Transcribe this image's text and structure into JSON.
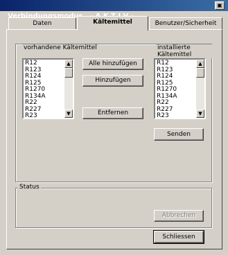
{
  "window": {
    "title": "Verbindungsmodus   - A K T I V -",
    "button_glyph": "▣"
  },
  "tabs": [
    {
      "label": "Daten"
    },
    {
      "label": "Kältemittel"
    },
    {
      "label": "Benutzer/Sicherheit"
    }
  ],
  "refrigerants": {
    "available_label": "vorhandene Kältemittel",
    "installed_label": "installierte Kältemittel",
    "available_items": [
      "R12",
      "R123",
      "R124",
      "R125",
      "R1270",
      "R134A",
      "R22",
      "R227",
      "R23"
    ],
    "installed_items": [
      "R12",
      "R123",
      "R124",
      "R125",
      "R1270",
      "R134A",
      "R22",
      "R227",
      "R23"
    ],
    "add_all_label": "Alle hinzufügen",
    "add_label": "Hinzufügen",
    "remove_label": "Entfernen",
    "send_label": "Senden"
  },
  "status": {
    "label": "Status",
    "abort_label": "Abbrechen"
  },
  "footer": {
    "close_label": "Schliessen"
  },
  "scroll_glyphs": {
    "up": "▲",
    "down": "▼"
  }
}
